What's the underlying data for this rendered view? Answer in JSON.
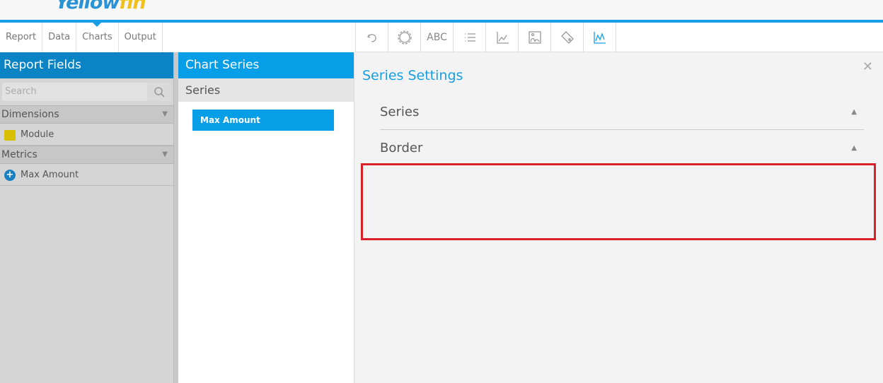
{
  "logo": {
    "part1": "Yellow",
    "part2": "fin"
  },
  "nav": {
    "tabs": [
      {
        "label": "Report"
      },
      {
        "label": "Data"
      },
      {
        "label": "Charts",
        "active": true
      },
      {
        "label": "Output"
      }
    ]
  },
  "toolbar": {
    "icons": [
      "undo-icon",
      "gear-icon",
      "text-abc-icon",
      "list-icon",
      "axis-chart-icon",
      "image-icon",
      "tag-icon",
      "line-series-icon"
    ],
    "abc_label": "ABC"
  },
  "report_fields": {
    "title": "Report Fields",
    "search_placeholder": "Search",
    "dimensions_label": "Dimensions",
    "dimension_items": [
      "Module"
    ],
    "metrics_label": "Metrics",
    "metric_items": [
      "Max Amount"
    ]
  },
  "chart_series": {
    "title": "Chart Series",
    "section": "Series",
    "items": [
      "Max Amount"
    ]
  },
  "series_settings": {
    "title": "Series Settings",
    "sections": [
      "Series",
      "Border"
    ]
  },
  "colors": {
    "accent": "#069ee6",
    "header_dark": "#0b84c5",
    "highlight": "#d9212a",
    "dimension": "#d8c000"
  }
}
